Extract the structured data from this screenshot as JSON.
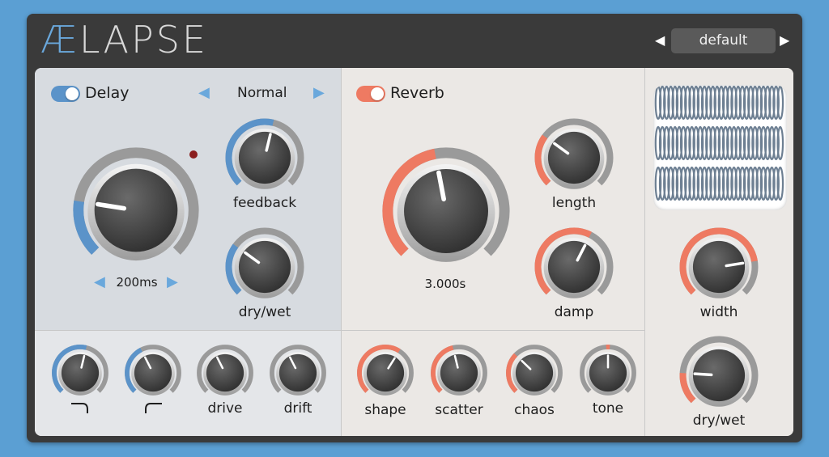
{
  "header": {
    "logo_ae": "Æ",
    "logo_rest": "LAPSE",
    "preset": "default",
    "prev_arrow": "◀",
    "next_arrow": "▶"
  },
  "colors": {
    "delay_accent": "#5b93c9",
    "reverb_accent": "#ee7a62"
  },
  "delay": {
    "title": "Delay",
    "enabled": true,
    "mode": "Normal",
    "time_value": "200ms",
    "knobs": {
      "time": {
        "label": "",
        "value": 0.2
      },
      "feedback": {
        "label": "feedback",
        "value": 0.55
      },
      "dry_wet": {
        "label": "dry/wet",
        "value": 0.3
      }
    },
    "bottom_knobs": [
      {
        "label": "⌐",
        "value": 0.55
      },
      {
        "label": "⌐",
        "value": 0.4
      },
      {
        "label": "drive",
        "value": 0.4
      },
      {
        "label": "drift",
        "value": 0.4
      }
    ]
  },
  "reverb": {
    "title": "Reverb",
    "enabled": true,
    "length_value": "3.000s",
    "knobs": {
      "size": {
        "label": "",
        "value": 0.46
      },
      "length": {
        "label": "length",
        "value": 0.3
      },
      "damp": {
        "label": "damp",
        "value": 0.6
      }
    },
    "bottom_knobs": [
      {
        "label": "shape",
        "value": 0.62
      },
      {
        "label": "scatter",
        "value": 0.45
      },
      {
        "label": "chaos",
        "value": 0.33
      },
      {
        "label": "tone",
        "value": 0.5
      }
    ]
  },
  "global": {
    "width": {
      "label": "width",
      "value": 0.8
    },
    "dry_wet": {
      "label": "dry/wet",
      "value": 0.18
    }
  }
}
